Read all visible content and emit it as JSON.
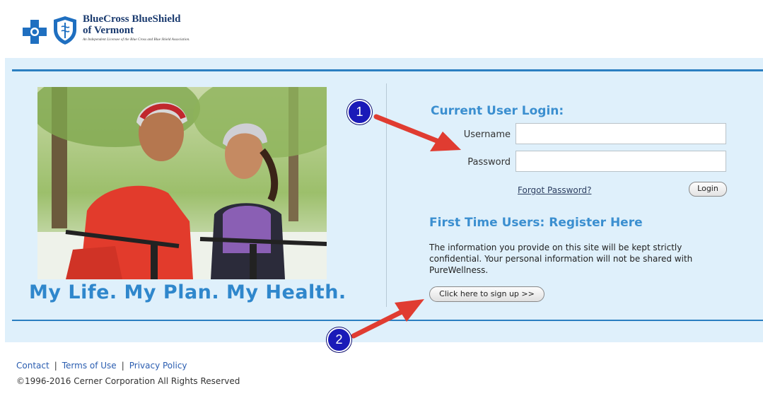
{
  "brand": {
    "line1": "BlueCross BlueShield",
    "line2": "of Vermont",
    "line3": "An Independent Licensee of the Blue Cross and Blue Shield Association."
  },
  "hero": {
    "tagline": "My Life. My Plan. My Health."
  },
  "login": {
    "heading": "Current User Login:",
    "username_label": "Username",
    "username_value": "",
    "password_label": "Password",
    "password_value": "",
    "forgot_link": "Forgot Password?",
    "login_button": "Login"
  },
  "register": {
    "heading": "First Time Users: Register Here",
    "text": "The information you provide on this site will be kept strictly confidential. Your personal information will not be shared with PureWellness.",
    "signup_button": "Click here to sign up >>"
  },
  "annotations": {
    "badge1": "1",
    "badge2": "2"
  },
  "footer": {
    "links": [
      "Contact",
      "Terms of Use",
      "Privacy Policy"
    ],
    "separator": "|",
    "copyright": "©1996-2016 Cerner Corporation All Rights Reserved"
  },
  "colors": {
    "accent": "#3b8fd0",
    "band": "#dff0fb",
    "rule": "#2b7fc1",
    "arrow": "#e03c31",
    "badge": "#1a1ab8"
  }
}
